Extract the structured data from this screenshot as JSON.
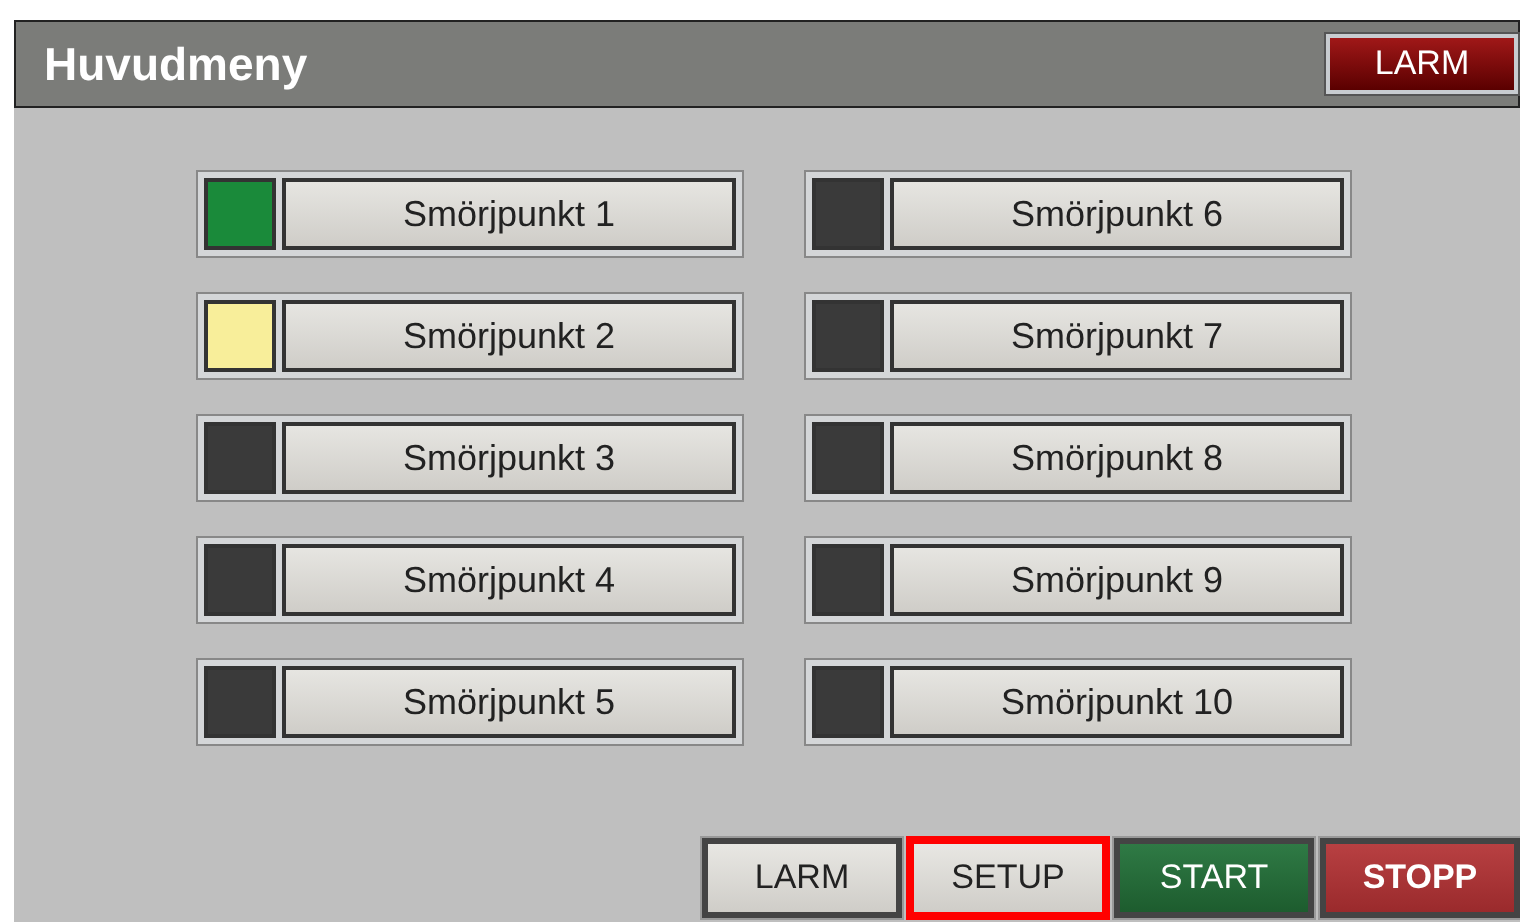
{
  "header": {
    "title": "Huvudmeny",
    "alarm_button": "LARM"
  },
  "points": [
    {
      "label": "Smörjpunkt 1",
      "color": "#1a8a3a"
    },
    {
      "label": "Smörjpunkt 2",
      "color": "#f8ee9a"
    },
    {
      "label": "Smörjpunkt 3",
      "color": "#3a3a3a"
    },
    {
      "label": "Smörjpunkt 4",
      "color": "#3a3a3a"
    },
    {
      "label": "Smörjpunkt 5",
      "color": "#3a3a3a"
    },
    {
      "label": "Smörjpunkt 6",
      "color": "#3a3a3a"
    },
    {
      "label": "Smörjpunkt 7",
      "color": "#3a3a3a"
    },
    {
      "label": "Smörjpunkt 8",
      "color": "#3a3a3a"
    },
    {
      "label": "Smörjpunkt 9",
      "color": "#3a3a3a"
    },
    {
      "label": "Smörjpunkt 10",
      "color": "#3a3a3a"
    }
  ],
  "bottom_buttons": [
    {
      "label": "LARM",
      "kind": "neutral",
      "selected": false
    },
    {
      "label": "SETUP",
      "kind": "neutral",
      "selected": true
    },
    {
      "label": "START",
      "kind": "start",
      "selected": false
    },
    {
      "label": "STOPP",
      "kind": "stop",
      "selected": false
    }
  ]
}
